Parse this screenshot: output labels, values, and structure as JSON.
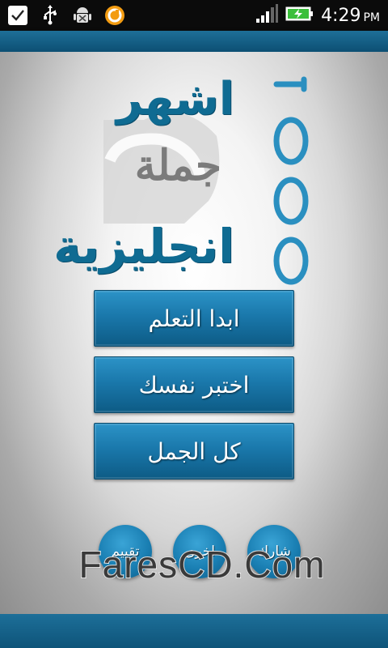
{
  "status_bar": {
    "time": "4:29",
    "ampm": "PM",
    "icons": [
      "checkbox-notification-icon",
      "usb-icon",
      "android-debug-icon",
      "app-notification-icon",
      "signal-icon",
      "battery-charging-icon"
    ]
  },
  "logo": {
    "line_top": "اشهر",
    "line_middle": "جملة",
    "line_bottom": "انجليزية",
    "number": "1000"
  },
  "buttons": {
    "start_learning": "ابدا التعلم",
    "test_yourself": "اختبر نفسك",
    "all_sentences": "كل الجمل"
  },
  "circle_buttons": {
    "rate": "تقييم",
    "other": "اخرى",
    "share": "شارك"
  },
  "watermark": "FaresCD.Com",
  "colors": {
    "accent": "#1a78ab",
    "bar": "#0e5479",
    "logo_text": "#0f6b92"
  }
}
